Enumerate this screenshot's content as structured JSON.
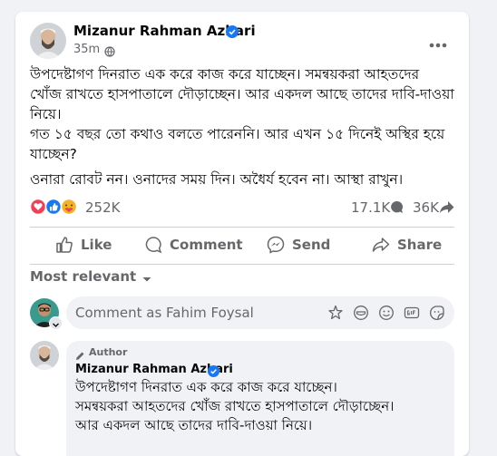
{
  "post": {
    "author": "Mizanur Rahman Azhari",
    "time": "35m",
    "paragraphs": [
      "উপদেষ্টাগণ দিনরাত এক করে কাজ করে যাচ্ছেন। সমন্বয়করা আহতদের খোঁজ রাখতে হাসপাতালে দৌড়াচ্ছেন। আর একদল আছে তাদের দাবি-দাওয়া নিয়ে।",
      "গত ১৫ বছর তো কথাও বলতে পারেননি। আর এখন ১৫ দিনেই অস্থির হয়ে যাচ্ছেন?",
      "ওনারা রোবট নন। ওনাদের সময় দিন। অধৈর্য হবেন না। আস্থা রাখুন।"
    ]
  },
  "stats": {
    "reactions": "252K",
    "comments": "17.1K",
    "shares": "36K"
  },
  "actions": {
    "like": "Like",
    "comment": "Comment",
    "send": "Send",
    "share": "Share"
  },
  "comments_section": {
    "filter": "Most relevant",
    "input_placeholder": "Comment as Fahim Foysal"
  },
  "reply": {
    "badge": "Author",
    "author": "Mizanur Rahman Azhari",
    "text_lines": [
      "উপদেষ্টাগণ দিনরাত এক করে কাজ করে যাচ্ছেন।",
      "সমন্বয়করা আহতদের খোঁজ রাখতে হাসপাতালে দৌড়াচ্ছেন।",
      "আর একদল আছে তাদের দাবি-দাওয়া নিয়ে।"
    ]
  },
  "colors": {
    "verified": "#1877f2",
    "like_blue": "#1877f2",
    "love_red": "#f33e58",
    "care_yellow": "#f7b125"
  }
}
